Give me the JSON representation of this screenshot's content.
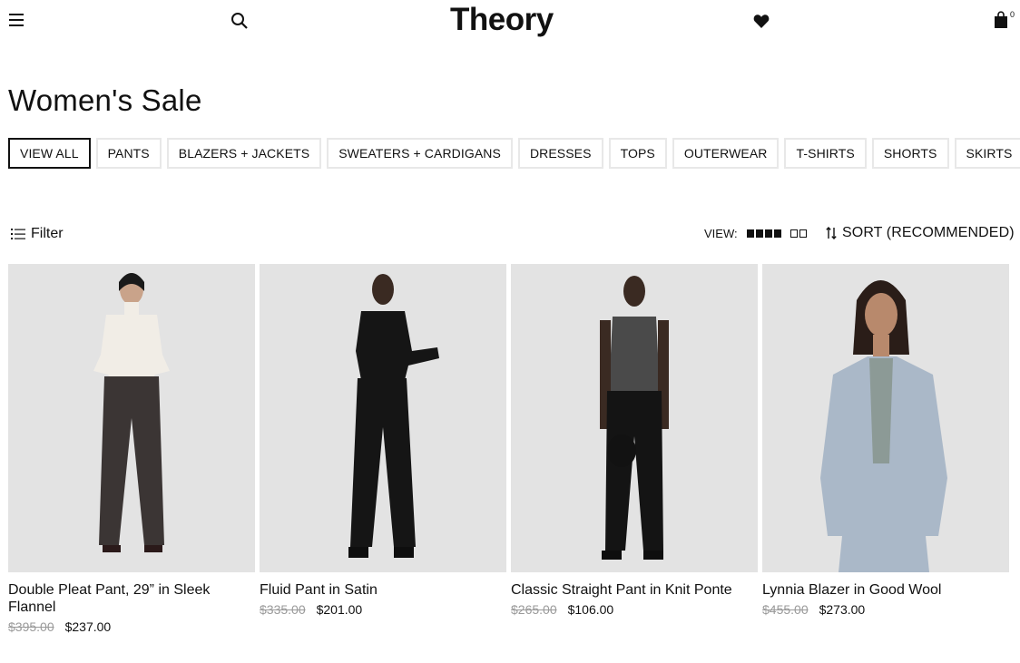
{
  "header": {
    "logo": "Theory",
    "bag_count": "0"
  },
  "page_title": "Women's Sale",
  "categories": [
    {
      "label": "VIEW ALL",
      "active": true
    },
    {
      "label": "PANTS"
    },
    {
      "label": "BLAZERS + JACKETS"
    },
    {
      "label": "SWEATERS + CARDIGANS"
    },
    {
      "label": "DRESSES"
    },
    {
      "label": "TOPS"
    },
    {
      "label": "OUTERWEAR"
    },
    {
      "label": "T-SHIRTS"
    },
    {
      "label": "SHORTS"
    },
    {
      "label": "SKIRTS"
    }
  ],
  "toolbar": {
    "filter_label": "Filter",
    "view_label": "VIEW:",
    "sort_label": "SORT (RECOMMENDED)"
  },
  "products": [
    {
      "name": "Double Pleat Pant, 29” in Sleek Flannel",
      "was": "$395.00",
      "now": "$237.00",
      "top_color": "#f1ede6",
      "bottom_color": "#3b3534"
    },
    {
      "name": "Fluid Pant in Satin",
      "was": "$335.00",
      "now": "$201.00",
      "top_color": "#151515",
      "bottom_color": "#151515"
    },
    {
      "name": "Classic Straight Pant in Knit Ponte",
      "was": "$265.00",
      "now": "$106.00",
      "top_color": "#4a4a4a",
      "bottom_color": "#141414"
    },
    {
      "name": "Lynnia Blazer in Good Wool",
      "was": "$455.00",
      "now": "$273.00",
      "top_color": "#aab8c8",
      "bottom_color": "#aab8c8"
    }
  ]
}
